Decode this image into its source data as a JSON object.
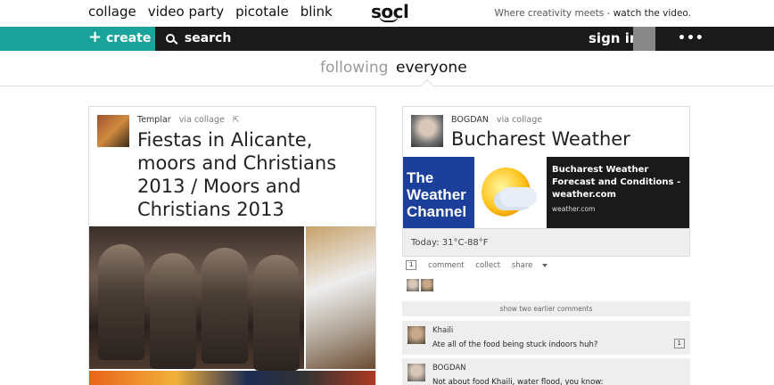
{
  "topnav": {
    "links": [
      "collage",
      "video party",
      "picotale",
      "blink"
    ],
    "logo": "socl",
    "tagline_prefix": "Where creativity meets -",
    "tagline_suffix": "watch the video."
  },
  "actionbar": {
    "create_label": "create",
    "search_label": "search",
    "signin_label": "sign in",
    "more_label": "•••"
  },
  "filters": {
    "following": "following",
    "everyone": "everyone",
    "active": "everyone"
  },
  "posts": [
    {
      "author": "Templar",
      "via": "via collage",
      "title": "Fiestas in Alicante, moors and Christians 2013 / Moors and Christians 2013"
    },
    {
      "author": "BOGDAN",
      "via": "via collage",
      "title": "Bucharest Weather",
      "embed": {
        "logo_text": "The Weather Channel",
        "link_title": "Bucharest Weather Forecast and Conditions - weather.com",
        "site": "weather.com"
      },
      "today": "Today: 31°C-88°F",
      "count": "1",
      "actions": {
        "comment": "comment",
        "collect": "collect",
        "share": "share"
      },
      "earlier_comments": "show two earlier comments",
      "comments": [
        {
          "author": "Khaili",
          "text": "Ate all of the food being stuck indoors huh?",
          "count": "1"
        },
        {
          "author": "BOGDAN",
          "text": "Not about food Khaili, water flood, you know:"
        }
      ]
    }
  ],
  "colors": {
    "accent": "#1aa39a",
    "bar": "#1a1a1a",
    "weather_blue": "#1b3f9b"
  }
}
